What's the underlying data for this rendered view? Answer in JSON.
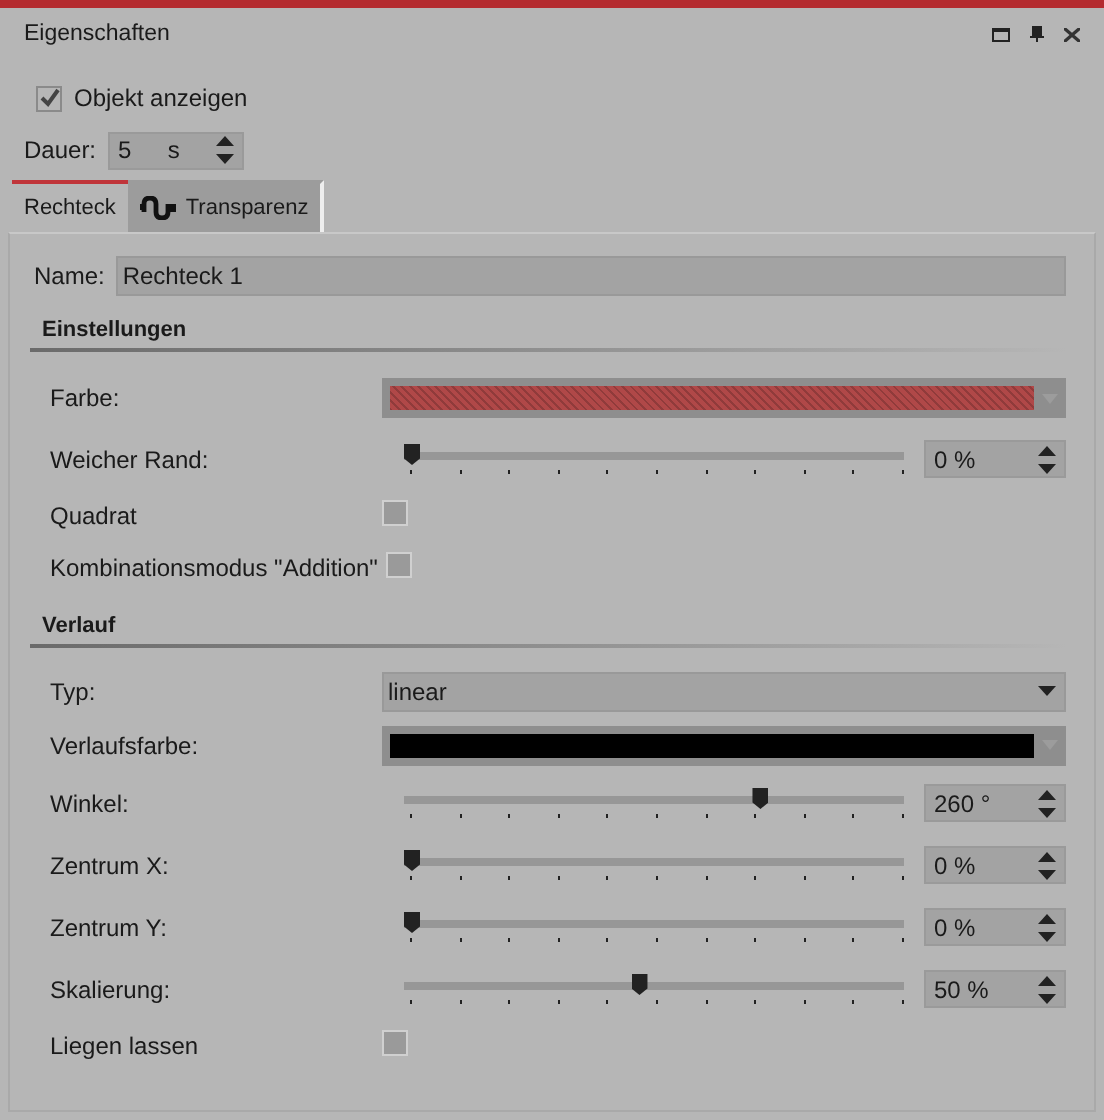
{
  "window": {
    "title": "Eigenschaften"
  },
  "show_object": {
    "label": "Objekt anzeigen",
    "checked": true
  },
  "duration": {
    "label": "Dauer:",
    "value": "5",
    "unit": "s"
  },
  "tabs": [
    {
      "label": "Rechteck",
      "selected": true
    },
    {
      "label": "Transparenz",
      "selected": false
    }
  ],
  "name": {
    "label": "Name:",
    "value": "Rechteck 1"
  },
  "sections": [
    {
      "title": "Einstellungen",
      "rows": [
        {
          "kind": "color",
          "label": "Farbe:",
          "color": "#b04848",
          "hatched": true
        },
        {
          "kind": "slider",
          "label": "Weicher Rand:",
          "level": 0,
          "reading": "0 %"
        },
        {
          "kind": "checkbox",
          "label": "Quadrat",
          "checked": false
        },
        {
          "kind": "checkbox",
          "label": "Kombinationsmodus \"Addition\"",
          "checked": false
        }
      ]
    },
    {
      "title": "Verlauf",
      "rows": [
        {
          "kind": "select",
          "label": "Typ:",
          "value": "linear"
        },
        {
          "kind": "color",
          "label": "Verlaufsfarbe:",
          "color": "#000000",
          "hatched": false
        },
        {
          "kind": "slider",
          "label": "Winkel:",
          "level": 0.72,
          "reading": "260 °"
        },
        {
          "kind": "slider",
          "label": "Zentrum X:",
          "level": 0,
          "reading": "0 %"
        },
        {
          "kind": "slider",
          "label": "Zentrum Y:",
          "level": 0,
          "reading": "0 %"
        },
        {
          "kind": "slider",
          "label": "Skalierung:",
          "level": 0.47,
          "reading": "50 %"
        },
        {
          "kind": "checkbox",
          "label": "Liegen lassen",
          "checked": false
        }
      ]
    }
  ]
}
